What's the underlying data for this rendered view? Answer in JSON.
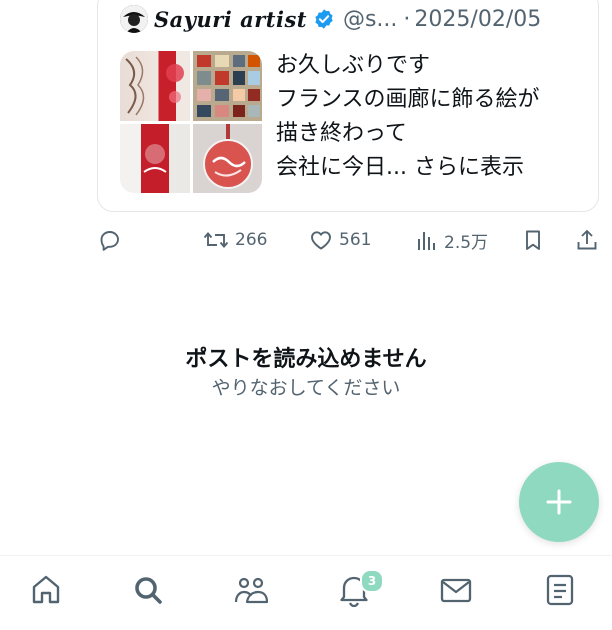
{
  "quoted_post": {
    "author_name": "Sayuri artist",
    "handle": "@s...",
    "separator": "·",
    "date": "2025/02/05",
    "text_lines": [
      "お久しぶりです",
      "フランスの画廊に飾る絵が",
      "描き終わって",
      "会社に今日..."
    ],
    "show_more": "さらに表示"
  },
  "actions": {
    "reply_count": "",
    "repost_count": "266",
    "like_count": "561",
    "views_count": "2.5万"
  },
  "error": {
    "title": "ポストを読み込めません",
    "subtitle": "やりなおしてください"
  },
  "tabbar": {
    "notifications_badge": "3"
  },
  "colors": {
    "accent": "#8fd9c1",
    "secondary_text": "#536471",
    "verified": "#1d9bf0"
  }
}
